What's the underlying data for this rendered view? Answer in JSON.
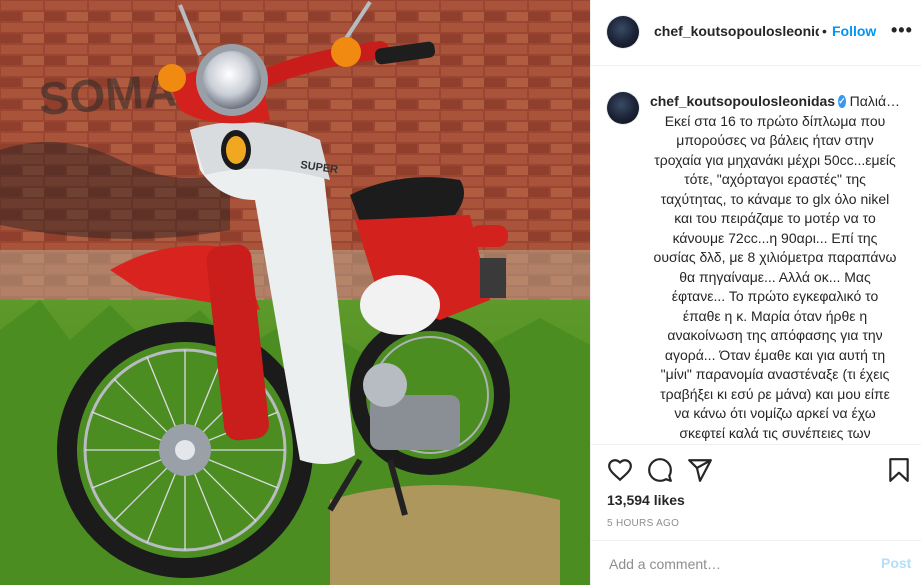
{
  "photo": {
    "alt_icon": "motorcycle-photo",
    "wall_graffiti": "SOMA"
  },
  "header": {
    "username": "chef_koutsopoulosleonidas",
    "separator": "•",
    "follow_label": "Follow",
    "more_icon": "more-options-icon",
    "more_label": "•••"
  },
  "caption": {
    "username": "chef_koutsopoulosleonidas",
    "verified_mark": "✓",
    "first_word": "Παλιά…",
    "body": "Εκεί στα 16 το πρώτο δίπλωμα που μπορούσες να βάλεις ήταν στην τροχαία για μηχανάκι μέχρι 50cc...εμείς τότε, \"αχόρταγοι εραστές\" της ταχύτητας, το κάναμε το glx όλο nikel και του πειράζαμε το μοτέρ να το κάνουμε 72cc...η 90αρι... Επί της ουσίας δλδ, με 8 χιλιόμετρα παραπάνω θα πηγαίναμε... Αλλά οκ... Μας έφτανε... Το πρώτο εγκεφαλικό το έπαθε η κ. Μαρία όταν ήρθε η ανακοίνωση της απόφασης για την αγορά... Όταν έμαθε και για αυτή τη \"μίνι\" παρανομία αναστέναξε (τι έχεις τραβήξει κι εσύ ρε μάνα) και μου είπε να κάνω ότι νομίζω αρκεί να έχω σκεφτεί καλά τις συνέπειες των πράξεων μου... Με Sebring εξάτμιση, άλλη ιδιοκτησία..."
  },
  "actions": {
    "like_icon": "heart-icon",
    "comment_icon": "comment-icon",
    "share_icon": "share-icon",
    "save_icon": "bookmark-icon",
    "likes_text": "13,594 likes",
    "timestamp": "5 HOURS AGO"
  },
  "comment": {
    "placeholder": "Add a comment…",
    "post_label": "Post"
  },
  "colors": {
    "accent": "#0095f6",
    "post_disabled": "#b2dffc",
    "text": "#262626",
    "muted": "#8e8e8e",
    "verified": "#3897f0"
  }
}
